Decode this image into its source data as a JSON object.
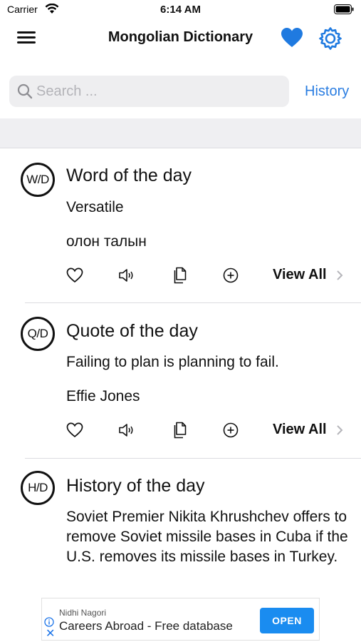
{
  "status_bar": {
    "carrier": "Carrier",
    "time": "6:14 AM"
  },
  "nav": {
    "title": "Mongolian Dictionary",
    "icons": {
      "menu": "hamburger-menu-icon",
      "favorite": "heart-icon",
      "settings": "gear-icon"
    },
    "accent_color": "#2a7de1"
  },
  "search": {
    "placeholder": "Search ...",
    "value": "",
    "history_label": "History"
  },
  "cards": [
    {
      "badge": "W/D",
      "title": "Word of the day",
      "line1": "Versatile",
      "line2": "олон талын",
      "view_all": "View All"
    },
    {
      "badge": "Q/D",
      "title": "Quote of the day",
      "line1": "Failing to plan is planning to fail.",
      "line2": "Effie Jones",
      "view_all": "View All"
    },
    {
      "badge": "H/D",
      "title": "History of the day",
      "body": "Soviet Premier Nikita Khrushchev offers to remove Soviet missile bases in Cuba if the U.S. removes its missile bases in Turkey."
    }
  ],
  "action_icons": [
    "heart-outline-icon",
    "speaker-icon",
    "copy-icon",
    "plus-circle-icon",
    "chevron-right-icon"
  ],
  "ad": {
    "sponsor": "Nidhi Nagori",
    "text": "Careers Abroad - Free database",
    "cta": "OPEN",
    "cta_color": "#1a8cf0"
  }
}
